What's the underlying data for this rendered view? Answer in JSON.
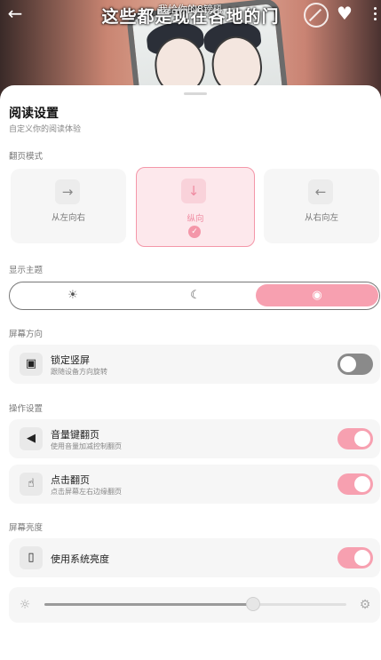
{
  "header": {
    "caption_small": "我给你的8镑吼",
    "caption_big": "这些都是现在各地的门",
    "back_icon": "arrow-left-icon",
    "block_icon": "ban-icon",
    "favorite_icon": "heart-icon",
    "more_icon": "more-vertical-icon"
  },
  "sheet": {
    "title": "阅读设置",
    "subtitle": "自定义你的阅读体验"
  },
  "page_mode": {
    "section_label": "翻页模式",
    "options": [
      {
        "label": "从左向右",
        "icon": "arrow-right-icon",
        "selected": false
      },
      {
        "label": "纵向",
        "icon": "arrow-down-icon",
        "selected": true
      },
      {
        "label": "从右向左",
        "icon": "arrow-left-icon",
        "selected": false
      }
    ]
  },
  "theme": {
    "section_label": "显示主题",
    "options": [
      {
        "icon": "sun-icon",
        "selected": false
      },
      {
        "icon": "moon-icon",
        "selected": false
      },
      {
        "icon": "auto-theme-icon",
        "selected": true
      }
    ]
  },
  "orientation": {
    "section_label": "屏幕方向",
    "lock": {
      "name": "锁定竖屏",
      "desc": "跟随设备方向旋转",
      "icon": "phone-lock-icon",
      "on": false
    }
  },
  "controls": {
    "section_label": "操作设置",
    "volume": {
      "name": "音量键翻页",
      "desc": "使用音量加减控制翻页",
      "icon": "volume-icon",
      "on": true
    },
    "tap": {
      "name": "点击翻页",
      "desc": "点击屏幕左右边缘翻页",
      "icon": "tap-icon",
      "on": true
    }
  },
  "brightness": {
    "section_label": "屏幕亮度",
    "system": {
      "name": "使用系统亮度",
      "icon": "phone-icon",
      "on": true
    },
    "level": 0.69
  },
  "colors": {
    "accent": "#f7a0b0",
    "accent_light": "#fde8ec",
    "toggle_off": "#8a8a8a"
  }
}
